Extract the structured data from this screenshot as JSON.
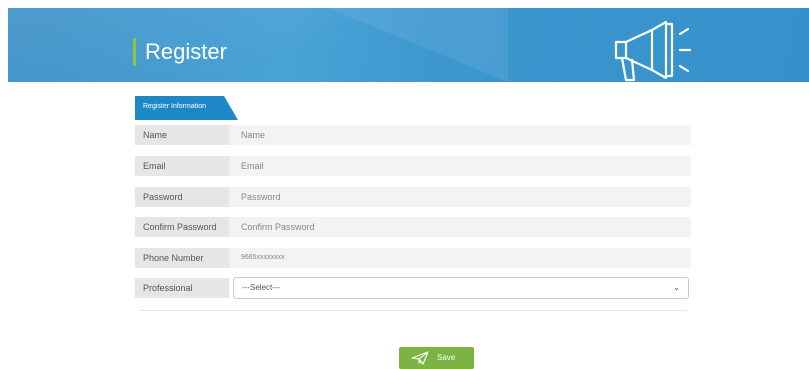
{
  "banner": {
    "title": "Register"
  },
  "form": {
    "section_tab": "Register Information",
    "fields": [
      {
        "label": "Name",
        "placeholder": "Name"
      },
      {
        "label": "Email",
        "placeholder": "Email"
      },
      {
        "label": "Password",
        "placeholder": "Password"
      },
      {
        "label": "Confirm Password",
        "placeholder": "Confirm Password"
      },
      {
        "label": "Phone Number",
        "placeholder": "9665xxxxxxxx"
      }
    ],
    "professional": {
      "label": "Professional",
      "selected": "---Select---"
    }
  },
  "actions": {
    "save_label": "Save"
  },
  "icons": {
    "banner": "megaphone-icon",
    "save": "paper-plane-icon",
    "select": "chevron-down-icon"
  },
  "colors": {
    "banner": "#3d97cf",
    "accent": "#8dc63f",
    "save_button": "#7cb342",
    "tab": "#1e88c7"
  }
}
